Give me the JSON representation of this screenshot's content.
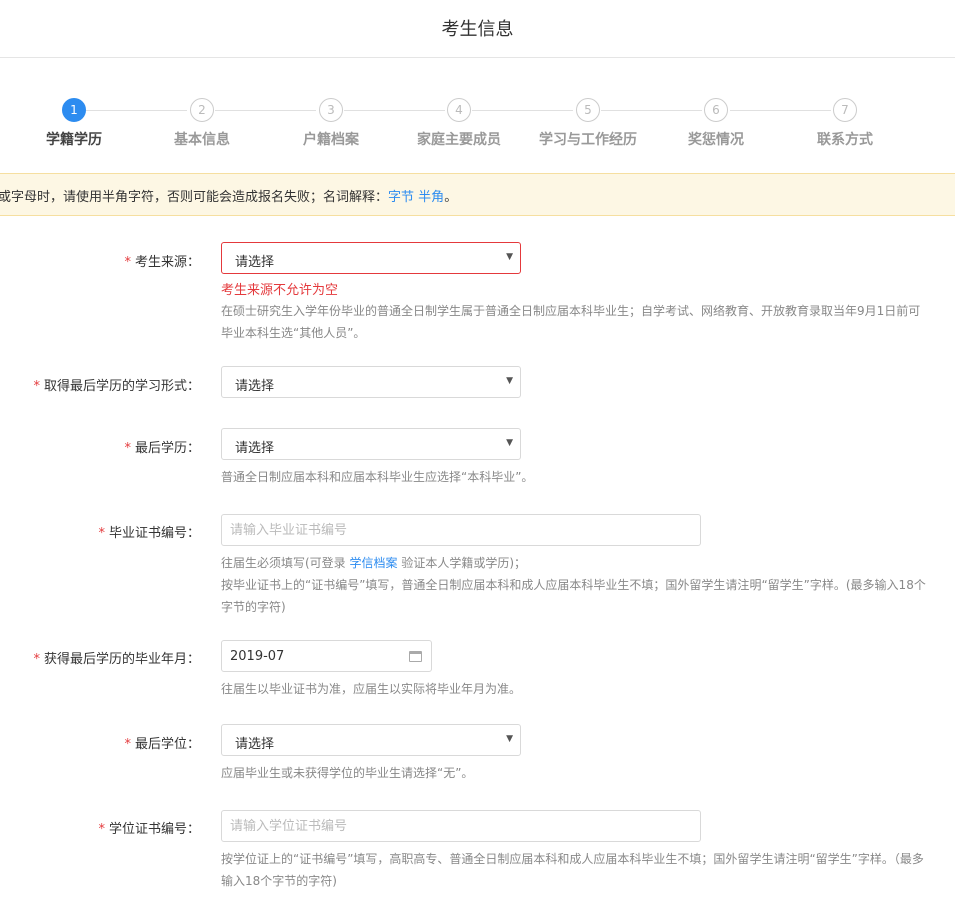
{
  "header": {
    "title": "考生信息"
  },
  "steps": [
    {
      "num": "1",
      "label": "学籍学历"
    },
    {
      "num": "2",
      "label": "基本信息"
    },
    {
      "num": "3",
      "label": "户籍档案"
    },
    {
      "num": "4",
      "label": "家庭主要成员"
    },
    {
      "num": "5",
      "label": "学习与工作经历"
    },
    {
      "num": "6",
      "label": "奖惩情况"
    },
    {
      "num": "7",
      "label": "联系方式"
    }
  ],
  "notice": {
    "text": "或字母时，请使用半角字符，否则可能会造成报名失败；名词解释：",
    "link1": "字节",
    "link2": "半角",
    "end": "。"
  },
  "form": {
    "required_mark": "*",
    "source": {
      "label": "考生来源：",
      "value": "请选择",
      "error": "考生来源不允许为空",
      "help": "在硕士研究生入学年份毕业的普通全日制学生属于普通全日制应届本科毕业生；自学考试、网络教育、开放教育录取当年9月1日前可毕业本科生选“其他人员”。"
    },
    "study_form": {
      "label": "取得最后学历的学习形式：",
      "value": "请选择"
    },
    "last_edu": {
      "label": "最后学历：",
      "value": "请选择",
      "help": "普通全日制应届本科和应届本科毕业生应选择“本科毕业”。"
    },
    "diploma_no": {
      "label": "毕业证书编号：",
      "placeholder": "请输入毕业证书编号",
      "help_pre": "往届生必须填写(可登录",
      "help_link": "学信档案",
      "help_post": "验证本人学籍或学历)；",
      "help2": "按毕业证书上的“证书编号”填写，普通全日制应届本科和成人应届本科毕业生不填；国外留学生请注明“留学生”字样。(最多输入18个字节的字符)"
    },
    "grad_date": {
      "label": "获得最后学历的毕业年月：",
      "value": "2019-07",
      "help": "往届生以毕业证书为准，应届生以实际将毕业年月为准。"
    },
    "last_degree": {
      "label": "最后学位：",
      "value": "请选择",
      "help": "应届毕业生或未获得学位的毕业生请选择“无”。"
    },
    "degree_no": {
      "label": "学位证书编号：",
      "placeholder": "请输入学位证书编号",
      "help": "按学位证上的“证书编号”填写，高职高专、普通全日制应届本科和成人应届本科毕业生不填；国外留学生请注明“留学生”字样。（最多输入18个字节的字符)"
    }
  }
}
